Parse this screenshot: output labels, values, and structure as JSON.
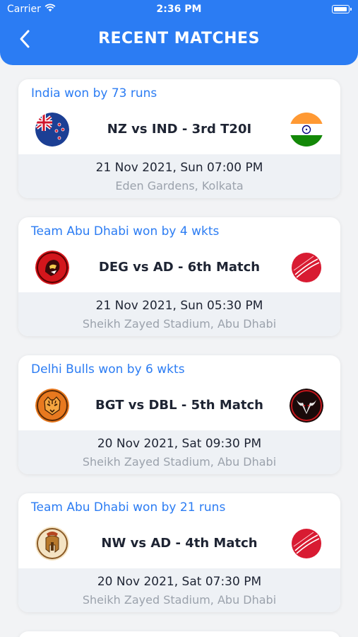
{
  "status_bar": {
    "carrier": "Carrier",
    "time": "2:36 PM"
  },
  "header": {
    "title": "RECENT MATCHES",
    "back_icon": "chevron-left-icon"
  },
  "colors": {
    "accent": "#2b7cf3",
    "header_bg": "#2b7cf3",
    "text_dark": "#1e2433",
    "muted": "#9ba2ac",
    "info_bg": "#eef1f5"
  },
  "matches": [
    {
      "result": "India won by 73 runs",
      "title": "NZ vs IND - 3rd T20I",
      "datetime": "21 Nov 2021, Sun 07:00 PM",
      "venue": "Eden Gardens,  Kolkata",
      "team1_logo": "new-zealand-flag-icon",
      "team2_logo": "india-flag-icon"
    },
    {
      "result": "Team Abu Dhabi won by 4 wkts",
      "title": "DEG vs AD - 6th Match",
      "datetime": "21 Nov 2021, Sun 05:30 PM",
      "venue": "Sheikh Zayed Stadium,  Abu Dhabi",
      "team1_logo": "deg-team-logo-icon",
      "team2_logo": "cricket-ball-icon"
    },
    {
      "result": "Delhi Bulls won by 6 wkts",
      "title": "BGT vs DBL - 5th Match",
      "datetime": "20 Nov 2021, Sat 09:30 PM",
      "venue": "Sheikh Zayed Stadium,  Abu Dhabi",
      "team1_logo": "tiger-logo-icon",
      "team2_logo": "bull-logo-icon"
    },
    {
      "result": "Team Abu Dhabi won by 21 runs",
      "title": "NW vs AD - 4th Match",
      "datetime": "20 Nov 2021, Sat 07:30 PM",
      "venue": "Sheikh Zayed Stadium,  Abu Dhabi",
      "team1_logo": "warrior-helmet-logo-icon",
      "team2_logo": "cricket-ball-icon"
    }
  ]
}
